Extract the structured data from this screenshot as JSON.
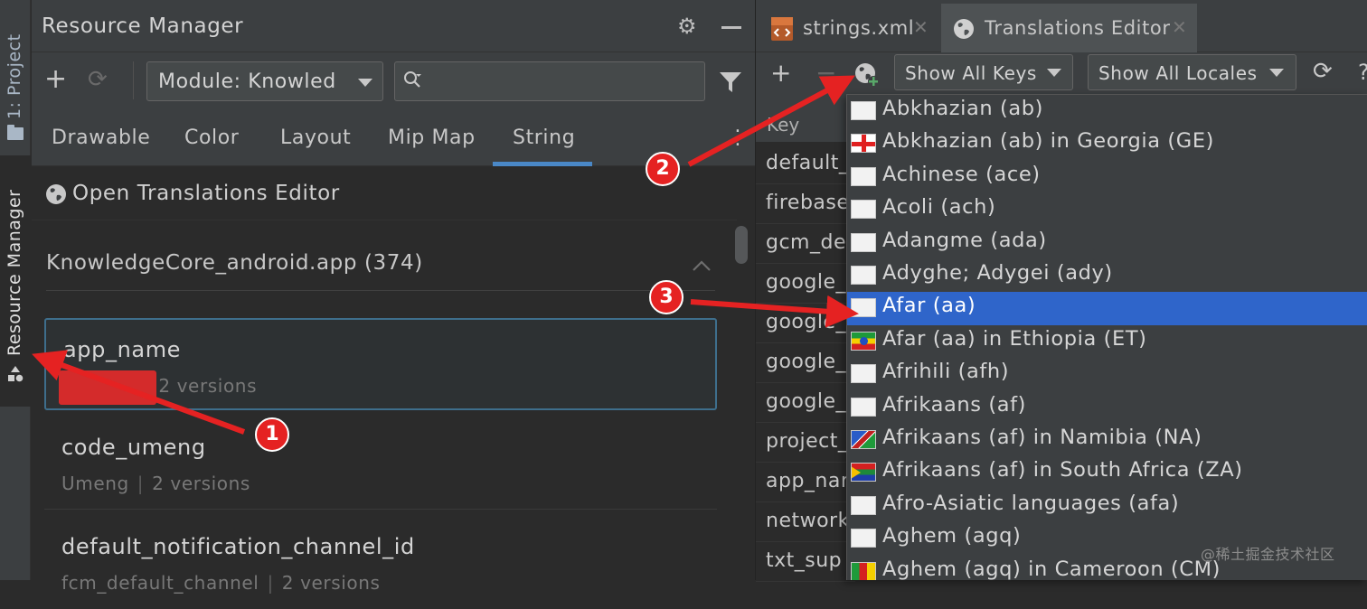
{
  "side_strip": {
    "project_tab": "1: Project",
    "resource_manager_tab": "Resource Manager"
  },
  "resource_manager": {
    "title": "Resource Manager",
    "module_select": "Module: Knowled",
    "search": {
      "value": "",
      "placeholder": ""
    },
    "tabs": [
      "Drawable",
      "Color",
      "Layout",
      "Mip Map",
      "String"
    ],
    "active_tab": "String",
    "open_translations_editor": "Open Translations Editor",
    "group_title": "KnowledgeCore_android.app (374)",
    "items": [
      {
        "name": "app_name",
        "value": "",
        "versions": "2 versions"
      },
      {
        "name": "code_umeng",
        "value": "Umeng",
        "versions": "2 versions"
      },
      {
        "name": "default_notification_channel_id",
        "value": "fcm_default_channel",
        "versions": "2 versions"
      }
    ]
  },
  "editor": {
    "tabs": [
      {
        "label": "strings.xml",
        "active": false
      },
      {
        "label": "Translations Editor",
        "active": true
      }
    ],
    "show_keys": "Show All Keys",
    "show_locales": "Show All Locales",
    "key_header": "Key",
    "keys": [
      "default_",
      "firebase",
      "gcm_de",
      "google_",
      "google_",
      "google_",
      "google_",
      "project_",
      "app_nar",
      "network",
      "txt_sup"
    ]
  },
  "locale_dropdown": {
    "selected_index": 6,
    "items": [
      {
        "label": "Abkhazian (ab)",
        "flag": "none"
      },
      {
        "label": "Abkhazian (ab) in Georgia (GE)",
        "flag": "ge"
      },
      {
        "label": "Achinese (ace)",
        "flag": "none"
      },
      {
        "label": "Acoli (ach)",
        "flag": "none"
      },
      {
        "label": "Adangme (ada)",
        "flag": "none"
      },
      {
        "label": "Adyghe; Adygei (ady)",
        "flag": "none"
      },
      {
        "label": "Afar (aa)",
        "flag": "none"
      },
      {
        "label": "Afar (aa) in Ethiopia (ET)",
        "flag": "et"
      },
      {
        "label": "Afrihili (afh)",
        "flag": "none"
      },
      {
        "label": "Afrikaans (af)",
        "flag": "none"
      },
      {
        "label": "Afrikaans (af) in Namibia (NA)",
        "flag": "na"
      },
      {
        "label": "Afrikaans (af) in South Africa (ZA)",
        "flag": "za"
      },
      {
        "label": "Afro-Asiatic languages (afa)",
        "flag": "none"
      },
      {
        "label": "Aghem (agq)",
        "flag": "none"
      },
      {
        "label": "Aghem (agq) in Cameroon (CM)",
        "flag": "cm"
      }
    ]
  },
  "annotations": {
    "badges": [
      "1",
      "2",
      "3"
    ],
    "color": "#e52222"
  },
  "watermark": "@稀土掘金技术社区",
  "colors": {
    "accent": "#4a88c7",
    "selection": "#2f65ca",
    "panel": "#3c3f41",
    "background": "#2b2b2b"
  }
}
